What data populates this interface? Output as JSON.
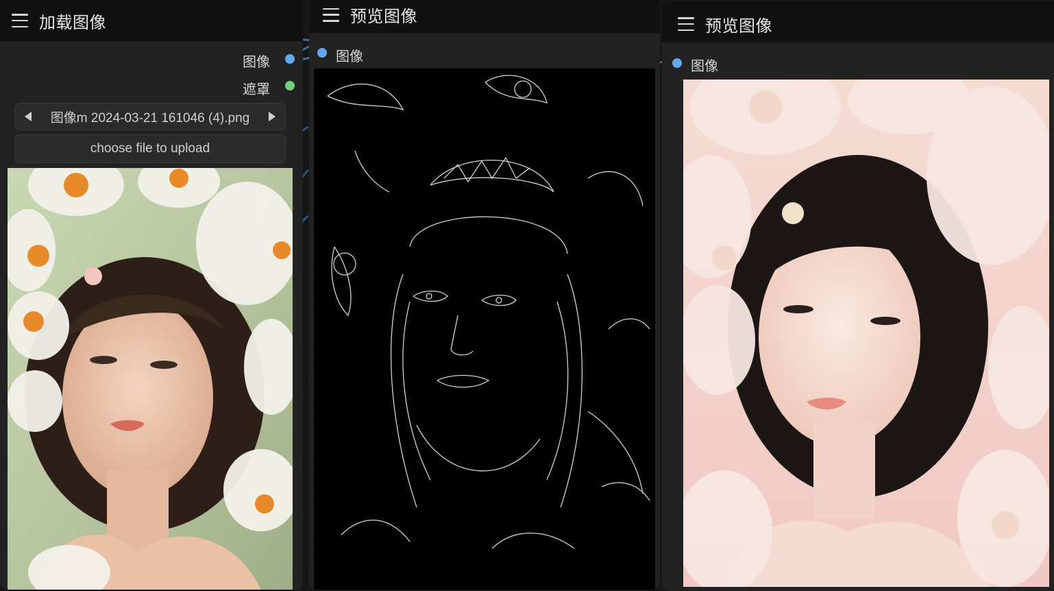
{
  "load_node": {
    "title": "加载图像",
    "outputs": {
      "image_label": "图像",
      "mask_label": "遮罩"
    },
    "file_widget": {
      "value": "图像m 2024-03-21 161046 (4).png"
    },
    "upload_button": {
      "label": "choose file to upload"
    }
  },
  "preview_node_1": {
    "title": "预览图像",
    "input_label": "图像"
  },
  "preview_node_2": {
    "title": "预览图像",
    "input_label": "图像"
  },
  "colors": {
    "canvas": "#161616",
    "node_body": "#222222",
    "node_header": "#111111",
    "link": "#3f6c96",
    "image_slot": "#64a8f0",
    "mask_slot": "#77cf7d"
  }
}
